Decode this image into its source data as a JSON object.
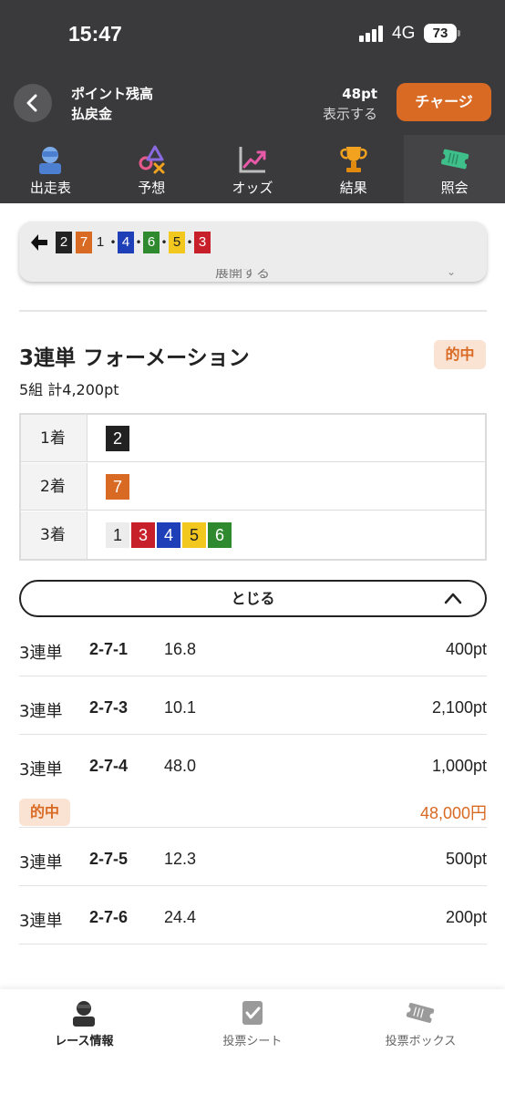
{
  "status_bar": {
    "time": "15:47",
    "network": "4G",
    "battery": "73"
  },
  "header": {
    "point_label": "ポイント残高",
    "refund_label": "払戻金",
    "point_value": "48pt",
    "display_label": "表示する",
    "charge_button": "チャージ"
  },
  "tabs": [
    {
      "label": "出走表",
      "icon": "runner-table-icon"
    },
    {
      "label": "予想",
      "icon": "prediction-icon"
    },
    {
      "label": "オッズ",
      "icon": "odds-chart-icon"
    },
    {
      "label": "結果",
      "icon": "trophy-icon"
    },
    {
      "label": "照会",
      "icon": "ticket-icon",
      "active": true
    }
  ],
  "race_order": {
    "expand_label": "展開する",
    "items": [
      {
        "num": "2",
        "color": "#222222",
        "text_color": "#ffffff"
      },
      {
        "num": "7",
        "color": "#d96a23",
        "text_color": "#ffffff",
        "sep": false
      },
      {
        "num": "1",
        "color": "#ececec",
        "text_color": "#222222",
        "sep": true
      },
      {
        "num": "4",
        "color": "#1f3fb8",
        "text_color": "#ffffff",
        "sep": true
      },
      {
        "num": "6",
        "color": "#2f8a2f",
        "text_color": "#ffffff",
        "sep": true
      },
      {
        "num": "5",
        "color": "#f2c81f",
        "text_color": "#222222",
        "sep": true
      },
      {
        "num": "3",
        "color": "#c8202a",
        "text_color": "#ffffff",
        "sep": false
      }
    ]
  },
  "bet": {
    "title": "3連単 フォーメーション",
    "hit_badge": "的中",
    "summary": "5組 計4,200pt",
    "places": [
      {
        "label": "1着",
        "nums": [
          {
            "num": "2",
            "color": "#222222",
            "text_color": "#ffffff"
          }
        ]
      },
      {
        "label": "2着",
        "nums": [
          {
            "num": "7",
            "color": "#d96a23",
            "text_color": "#ffffff"
          }
        ]
      },
      {
        "label": "3着",
        "nums": [
          {
            "num": "1",
            "color": "#ececec",
            "text_color": "#222222"
          },
          {
            "num": "3",
            "color": "#c8202a",
            "text_color": "#ffffff"
          },
          {
            "num": "4",
            "color": "#1f3fb8",
            "text_color": "#ffffff"
          },
          {
            "num": "5",
            "color": "#f2c81f",
            "text_color": "#222222"
          },
          {
            "num": "6",
            "color": "#2f8a2f",
            "text_color": "#ffffff"
          }
        ]
      }
    ],
    "close_label": "とじる",
    "combos": [
      {
        "type": "3連単",
        "num": "2-7-1",
        "odds": "16.8",
        "amount": "400pt"
      },
      {
        "type": "3連単",
        "num": "2-7-3",
        "odds": "10.1",
        "amount": "2,100pt"
      },
      {
        "type": "3連単",
        "num": "2-7-4",
        "odds": "48.0",
        "amount": "1,000pt",
        "hit": "的中",
        "payout": "48,000円"
      },
      {
        "type": "3連単",
        "num": "2-7-5",
        "odds": "12.3",
        "amount": "500pt"
      },
      {
        "type": "3連単",
        "num": "2-7-6",
        "odds": "24.4",
        "amount": "200pt"
      }
    ]
  },
  "bottom_nav": [
    {
      "label": "レース情報",
      "icon": "race-info-icon",
      "active": true
    },
    {
      "label": "投票シート",
      "icon": "vote-sheet-icon"
    },
    {
      "label": "投票ボックス",
      "icon": "vote-box-icon"
    }
  ]
}
